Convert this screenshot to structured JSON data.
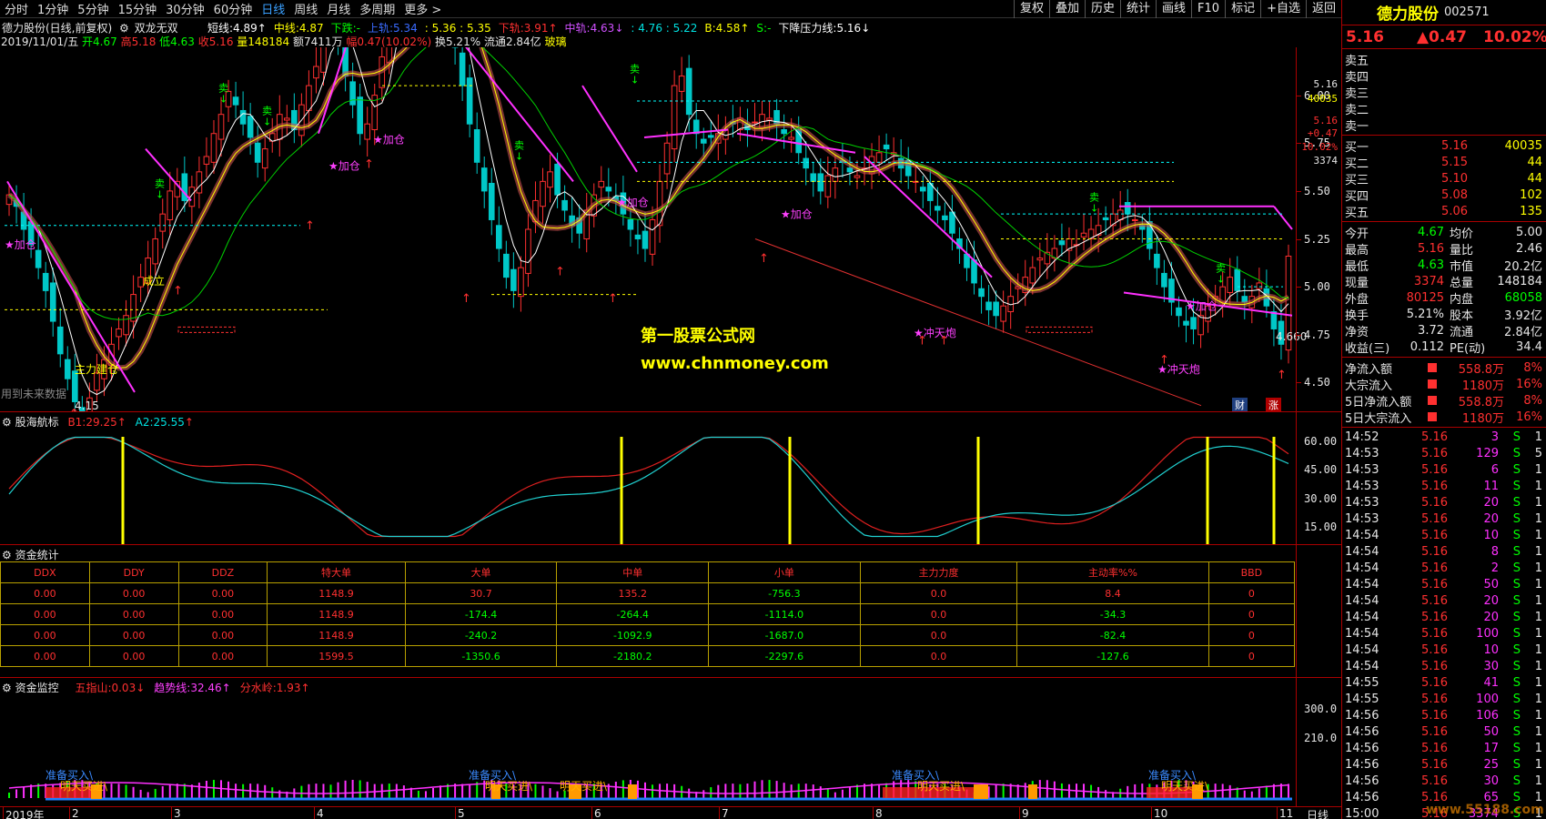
{
  "period_tabs": [
    "分时",
    "1分钟",
    "5分钟",
    "15分钟",
    "30分钟",
    "60分钟",
    "日线",
    "周线",
    "月线",
    "多周期",
    "更多 >"
  ],
  "active_tab": "日线",
  "toolbar": [
    "复权",
    "叠加",
    "历史",
    "统计",
    "画线",
    "F10",
    "标记",
    "+自选",
    "返回"
  ],
  "main_title": "德力股份(日线,前复权)",
  "formula_name": "双龙无双",
  "indicator_line": [
    {
      "label": "短线:",
      "value": "4.89",
      "arrow": "↑",
      "color": "#ffffff"
    },
    {
      "label": "中线:",
      "value": "4.87",
      "arrow": "",
      "color": "#ffff00"
    },
    {
      "label": "下跌:",
      "value": "-",
      "arrow": "",
      "color": "#00ff00"
    },
    {
      "label": "上轨:",
      "value": "5.34",
      "arrow": "",
      "color": "#3a6bff"
    },
    {
      "label": "",
      "value": ": 5.36 : 5.35",
      "arrow": "",
      "color": "#ffff00"
    },
    {
      "label": "下轨:",
      "value": "3.91",
      "arrow": "↑",
      "color": "#ff3030"
    },
    {
      "label": "中轨:",
      "value": "4.63",
      "arrow": "↓",
      "color": "#d050ff"
    },
    {
      "label": "",
      "value": ": 4.76 : 5.22",
      "arrow": "",
      "color": "#00e0e0"
    },
    {
      "label": "B:",
      "value": "4.58",
      "arrow": "↑",
      "color": "#ffff00"
    },
    {
      "label": "S:",
      "value": "-",
      "arrow": "",
      "color": "#00ff00"
    },
    {
      "label": "下降压力线:",
      "value": "5.16",
      "arrow": "↓",
      "color": "#ffffff"
    }
  ],
  "bar_info": {
    "date": "2019/11/01/五",
    "open": "开4.67",
    "high": "高5.18",
    "low": "低4.63",
    "close": "收5.16",
    "vol": "量148184",
    "amount": "额7411万",
    "change": "幅0.47(10.02%)",
    "turnover": "换5.21%",
    "float": "流通2.84亿",
    "sector": "玻璃"
  },
  "watermark": {
    "line1": "第一股票公式网",
    "line2": "www.chnmoney.com"
  },
  "main_chart": {
    "price_ticks": [
      "6.00",
      "5.75",
      "5.50",
      "5.25",
      "5.00",
      "4.75",
      "4.50"
    ],
    "right_labels": [
      "5.16",
      "40035",
      "5.16",
      "+0.47",
      "10.02%",
      "3374"
    ],
    "annotations": [
      "主力建仓",
      "成立",
      "加仓",
      "加仓",
      "加仓",
      "加仓",
      "加仓",
      "加仓",
      "冲天炮",
      "冲天炮",
      "7.28",
      "4.15",
      "4.660"
    ],
    "sell_mark": "卖",
    "notice": "用到未来数据",
    "badges": [
      "财",
      "涨"
    ]
  },
  "panel2": {
    "title": "股海航标",
    "b1_label": "B1:",
    "b1_value": "29.25",
    "a2_label": "A2:",
    "a2_value": "25.55",
    "ticks": [
      "60.00",
      "45.00",
      "30.00",
      "15.00"
    ]
  },
  "panel3": {
    "title": "资金统计",
    "headers": [
      "DDX",
      "DDY",
      "DDZ",
      "特大单",
      "大单",
      "中单",
      "小单",
      "主力力度",
      "主动率%%",
      "BBD"
    ],
    "rows": [
      [
        "0.00",
        "0.00",
        "0.00",
        "1148.9",
        "30.7",
        "135.2",
        "-756.3",
        "0.0",
        "8.4",
        "0"
      ],
      [
        "0.00",
        "0.00",
        "0.00",
        "1148.9",
        "-174.4",
        "-264.4",
        "-1114.0",
        "0.0",
        "-34.3",
        "0"
      ],
      [
        "0.00",
        "0.00",
        "0.00",
        "1148.9",
        "-240.2",
        "-1092.9",
        "-1687.0",
        "0.0",
        "-82.4",
        "0"
      ],
      [
        "0.00",
        "0.00",
        "0.00",
        "1599.5",
        "-1350.6",
        "-2180.2",
        "-2297.6",
        "0.0",
        "-127.6",
        "0"
      ]
    ]
  },
  "panel4": {
    "title": "资金监控",
    "items": [
      {
        "label": "五指山:",
        "value": "0.03",
        "arrow": "↓",
        "color": "#ff3030"
      },
      {
        "label": "趋势线:",
        "value": "32.46",
        "arrow": "↑",
        "color": "#ff40ff"
      },
      {
        "label": "分水岭:",
        "value": "1.93",
        "arrow": "↑",
        "color": "#ff3030"
      }
    ],
    "ticks": [
      "300.0",
      "210.0"
    ],
    "signals": [
      "准备买入",
      "明天买进",
      "准备买入",
      "明天买进",
      "明天买进",
      "准备买入",
      "明天买进",
      "准备买入",
      "明天买进"
    ]
  },
  "x_axis": [
    "2019年",
    "2",
    "3",
    "4",
    "5",
    "6",
    "7",
    "8",
    "9",
    "10",
    "11"
  ],
  "x_axis_label": "日线",
  "quote": {
    "name": "德力股份",
    "code": "002571",
    "price": "5.16",
    "change": "▲0.47",
    "pct": "10.02%",
    "asks": [
      {
        "label": "卖五",
        "price": "",
        "vol": ""
      },
      {
        "label": "卖四",
        "price": "",
        "vol": ""
      },
      {
        "label": "卖三",
        "price": "",
        "vol": ""
      },
      {
        "label": "卖二",
        "price": "",
        "vol": ""
      },
      {
        "label": "卖一",
        "price": "",
        "vol": ""
      }
    ],
    "bids": [
      {
        "label": "买一",
        "price": "5.16",
        "vol": "40035"
      },
      {
        "label": "买二",
        "price": "5.15",
        "vol": "44"
      },
      {
        "label": "买三",
        "price": "5.10",
        "vol": "44"
      },
      {
        "label": "买四",
        "price": "5.08",
        "vol": "102"
      },
      {
        "label": "买五",
        "price": "5.06",
        "vol": "135"
      }
    ],
    "stats": [
      [
        "今开",
        "4.67",
        "均价",
        "5.00"
      ],
      [
        "最高",
        "5.16",
        "量比",
        "2.46"
      ],
      [
        "最低",
        "4.63",
        "市值",
        "20.2亿"
      ],
      [
        "现量",
        "3374",
        "总量",
        "148184"
      ],
      [
        "外盘",
        "80125",
        "内盘",
        "68058"
      ],
      [
        "换手",
        "5.21%",
        "股本",
        "3.92亿"
      ],
      [
        "净资",
        "3.72",
        "流通",
        "2.84亿"
      ],
      [
        "收益(三)",
        "0.112",
        "PE(动)",
        "34.4"
      ]
    ],
    "flows": [
      [
        "净流入额",
        "558.8万",
        "8%"
      ],
      [
        "大宗流入",
        "1180万",
        "16%"
      ],
      [
        "5日净流入额",
        "558.8万",
        "8%"
      ],
      [
        "5日大宗流入",
        "1180万",
        "16%"
      ]
    ],
    "ticks": [
      [
        "14:52",
        "5.16",
        "3",
        "S",
        "1"
      ],
      [
        "14:53",
        "5.16",
        "129",
        "S",
        "5"
      ],
      [
        "14:53",
        "5.16",
        "6",
        "S",
        "1"
      ],
      [
        "14:53",
        "5.16",
        "11",
        "S",
        "1"
      ],
      [
        "14:53",
        "5.16",
        "20",
        "S",
        "1"
      ],
      [
        "14:53",
        "5.16",
        "20",
        "S",
        "1"
      ],
      [
        "14:54",
        "5.16",
        "10",
        "S",
        "1"
      ],
      [
        "14:54",
        "5.16",
        "8",
        "S",
        "1"
      ],
      [
        "14:54",
        "5.16",
        "2",
        "S",
        "1"
      ],
      [
        "14:54",
        "5.16",
        "50",
        "S",
        "1"
      ],
      [
        "14:54",
        "5.16",
        "20",
        "S",
        "1"
      ],
      [
        "14:54",
        "5.16",
        "20",
        "S",
        "1"
      ],
      [
        "14:54",
        "5.16",
        "100",
        "S",
        "1"
      ],
      [
        "14:54",
        "5.16",
        "10",
        "S",
        "1"
      ],
      [
        "14:54",
        "5.16",
        "30",
        "S",
        "1"
      ],
      [
        "14:55",
        "5.16",
        "41",
        "S",
        "1"
      ],
      [
        "14:55",
        "5.16",
        "100",
        "S",
        "1"
      ],
      [
        "14:56",
        "5.16",
        "106",
        "S",
        "1"
      ],
      [
        "14:56",
        "5.16",
        "50",
        "S",
        "1"
      ],
      [
        "14:56",
        "5.16",
        "17",
        "S",
        "1"
      ],
      [
        "14:56",
        "5.16",
        "25",
        "S",
        "1"
      ],
      [
        "14:56",
        "5.16",
        "30",
        "S",
        "1"
      ],
      [
        "14:56",
        "5.16",
        "65",
        "S",
        "1"
      ],
      [
        "15:00",
        "5.16",
        "3374",
        "S",
        "1"
      ]
    ],
    "bottom_watermark": "www.55188.com"
  },
  "colors": {
    "up": "#ff3030",
    "down": "#00c8c8",
    "bg": "#000000",
    "grid": "#a00000",
    "accent": "#3aa0ff"
  }
}
